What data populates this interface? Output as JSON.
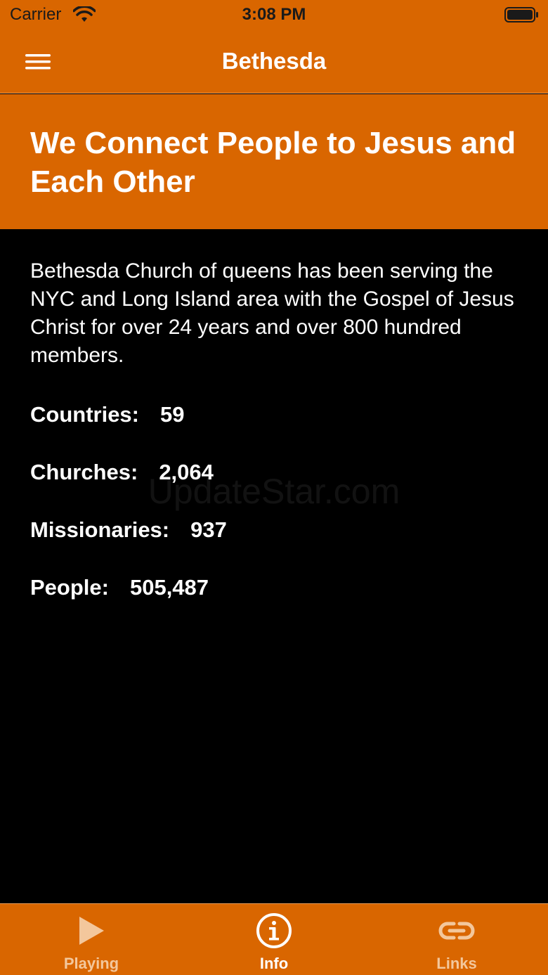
{
  "status_bar": {
    "carrier": "Carrier",
    "time": "3:08 PM"
  },
  "nav": {
    "title": "Bethesda"
  },
  "hero": {
    "headline": "We Connect People to Jesus and Each Other"
  },
  "content": {
    "description": "Bethesda Church of queens has been serving the NYC and Long Island area with the Gospel of Jesus Christ for over 24 years and over 800 hundred members.",
    "stats": [
      {
        "label": "Countries:",
        "value": "59"
      },
      {
        "label": "Churches:",
        "value": "2,064"
      },
      {
        "label": "Missionaries:",
        "value": "937"
      },
      {
        "label": "People:",
        "value": "505,487"
      }
    ]
  },
  "watermark": "UpdateStar.com",
  "tabs": [
    {
      "label": "Playing",
      "icon": "play-icon",
      "active": false
    },
    {
      "label": "Info",
      "icon": "info-icon",
      "active": true
    },
    {
      "label": "Links",
      "icon": "link-icon",
      "active": false
    }
  ],
  "colors": {
    "accent": "#d96600",
    "background": "#000000",
    "inactive_tab": "#f3c79c"
  }
}
